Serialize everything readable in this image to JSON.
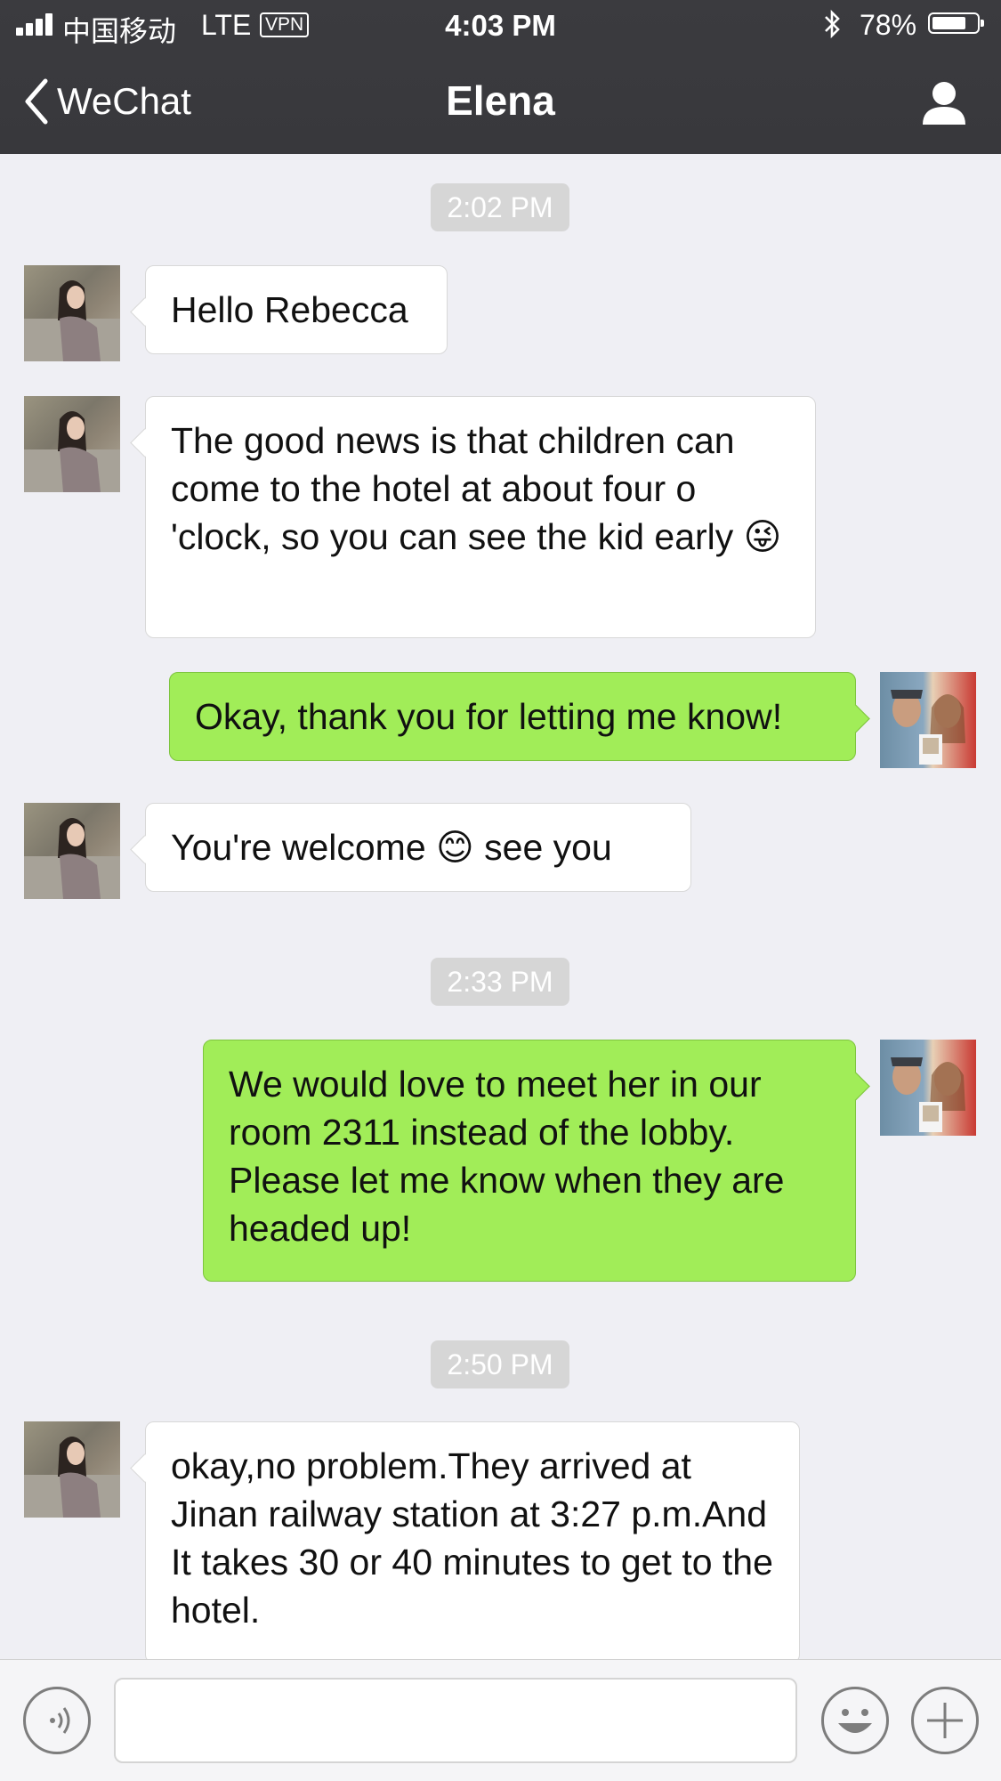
{
  "status_bar": {
    "carrier": "中国移动",
    "network": "LTE",
    "vpn": "VPN",
    "time": "4:03 PM",
    "battery": "78%",
    "battery_level": 0.78
  },
  "nav": {
    "back_label": "WeChat",
    "title": "Elena"
  },
  "messages": [
    {
      "type": "time",
      "text": "2:02 PM"
    },
    {
      "type": "in",
      "text": "Hello Rebecca"
    },
    {
      "type": "in",
      "text": "The good news is that children can come to the hotel at about four o 'clock, so you can see the kid early 😜"
    },
    {
      "type": "out",
      "text": "Okay, thank you for letting me know!"
    },
    {
      "type": "in",
      "text": "You're welcome 😊 see you"
    },
    {
      "type": "time",
      "text": "2:33 PM"
    },
    {
      "type": "out",
      "text": "We would love to meet her in our room 2311 instead of the lobby. Please let me know when they are headed up!"
    },
    {
      "type": "time",
      "text": "2:50 PM"
    },
    {
      "type": "in",
      "text": "okay,no problem.They arrived at Jinan railway station at 3:27 p.m.And It takes 30 or 40 minutes to get to the hotel."
    }
  ],
  "input": {
    "value": ""
  }
}
